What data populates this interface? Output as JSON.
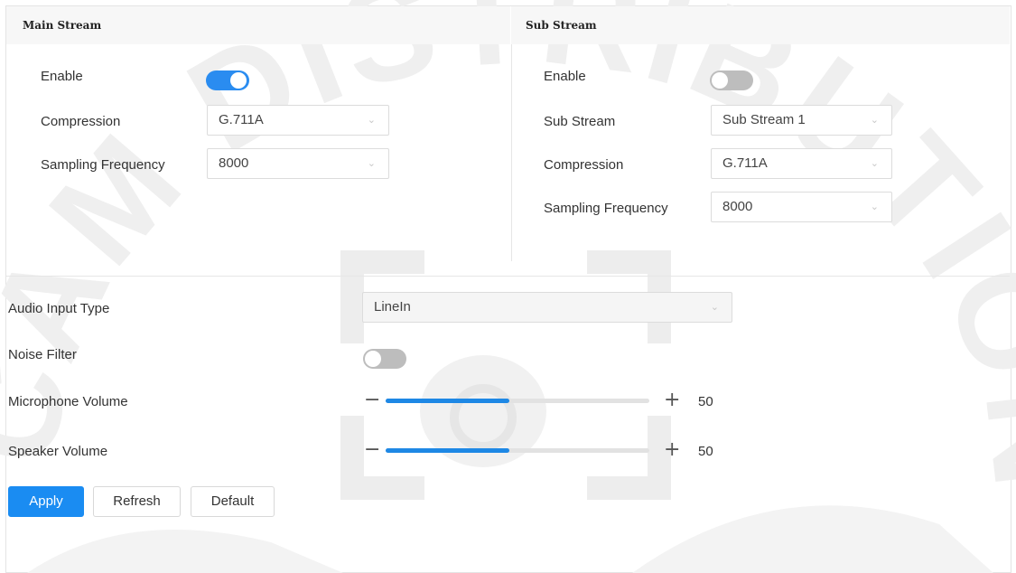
{
  "main_stream": {
    "title": "Main Stream",
    "enable_label": "Enable",
    "enabled": true,
    "compression_label": "Compression",
    "compression_value": "G.711A",
    "sampling_label": "Sampling Frequency",
    "sampling_value": "8000"
  },
  "sub_stream": {
    "title": "Sub Stream",
    "enable_label": "Enable",
    "enabled": false,
    "substream_label": "Sub Stream",
    "substream_value": "Sub Stream 1",
    "compression_label": "Compression",
    "compression_value": "G.711A",
    "sampling_label": "Sampling Frequency",
    "sampling_value": "8000"
  },
  "audio_input": {
    "label": "Audio Input  Type",
    "value": "LineIn"
  },
  "noise_filter": {
    "label": "Noise Filter",
    "enabled": false
  },
  "microphone_volume": {
    "label": "Microphone Volume",
    "minus": "−",
    "plus": "+",
    "value": "50",
    "fraction": 0.47
  },
  "speaker_volume": {
    "label": "Speaker Volume",
    "minus": "−",
    "plus": "+",
    "value": "50",
    "fraction": 0.47
  },
  "buttons": {
    "apply": "Apply",
    "refresh": "Refresh",
    "default": "Default"
  },
  "colors": {
    "accent": "#1a8cf2",
    "toggle_off": "#bdbdbd",
    "watermark": "#ececec"
  },
  "watermark_text": "CAM DISTRIBUTION"
}
